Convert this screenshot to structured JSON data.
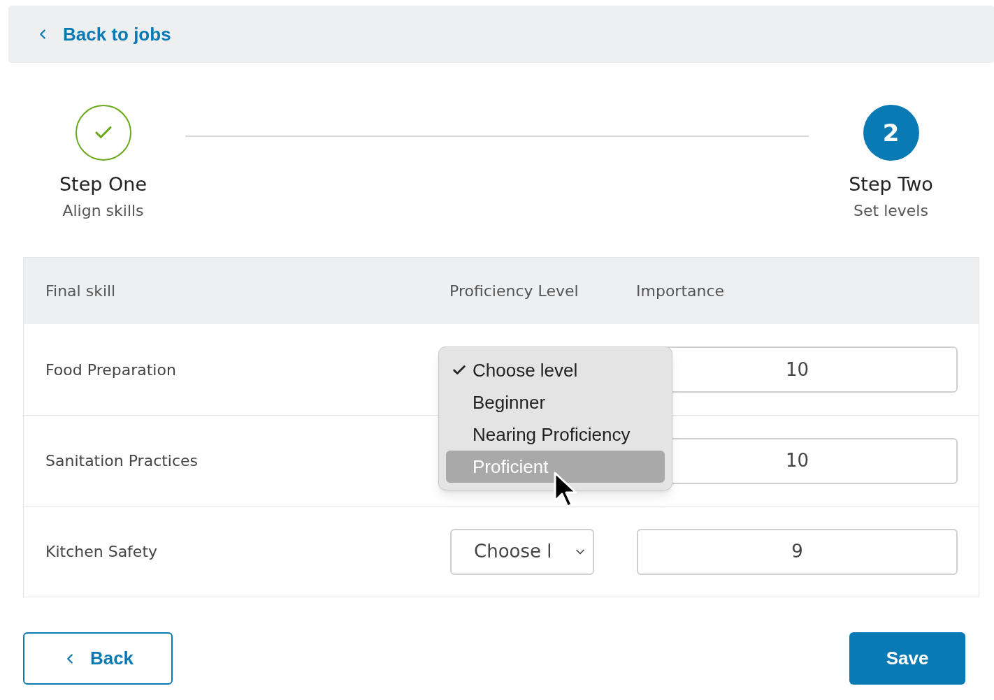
{
  "top_bar": {
    "back_link": "Back to jobs"
  },
  "steps": [
    {
      "kind": "done",
      "title": "Step One",
      "subtitle": "Align skills"
    },
    {
      "kind": "current",
      "number": "2",
      "title": "Step Two",
      "subtitle": "Set levels"
    }
  ],
  "table": {
    "columns": [
      "Final skill",
      "Proficiency Level",
      "Importance"
    ],
    "rows": [
      {
        "skill": "Food Preparation",
        "importance": "10"
      },
      {
        "skill": "Sanitation Practices",
        "importance": "10"
      },
      {
        "skill": "Kitchen Safety",
        "level": "Choose l",
        "importance": "9"
      }
    ]
  },
  "level_menu": {
    "options": [
      {
        "label": "Choose level",
        "checked": true,
        "selected": false
      },
      {
        "label": "Beginner",
        "checked": false,
        "selected": false
      },
      {
        "label": "Nearing Proficiency",
        "checked": false,
        "selected": false
      },
      {
        "label": "Proficient",
        "checked": false,
        "selected": true
      }
    ]
  },
  "buttons": {
    "back": "Back",
    "save": "Save"
  }
}
